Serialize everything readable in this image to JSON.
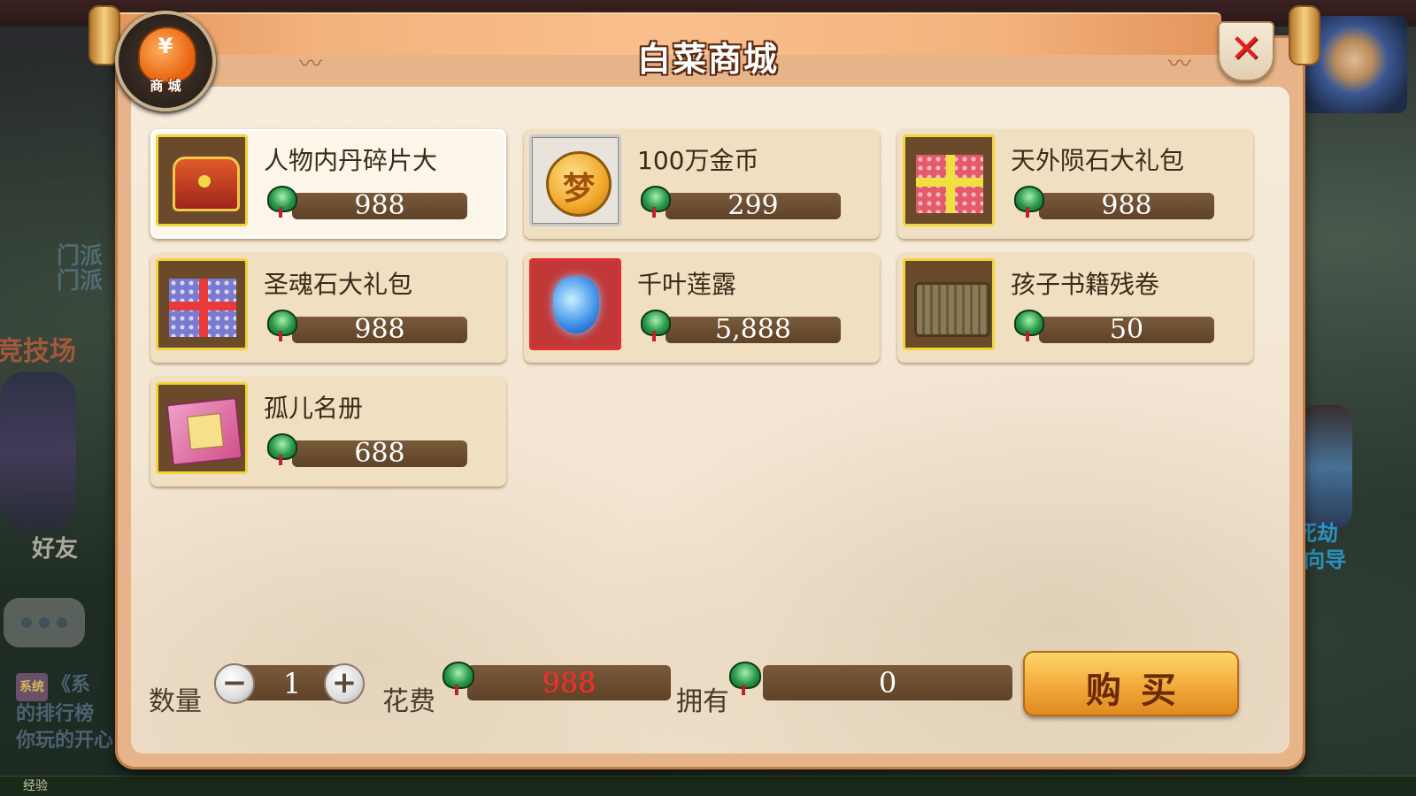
{
  "window": {
    "title": "白菜商城",
    "shop_badge_label": "商 城",
    "shop_badge_symbol": "¥",
    "close_symbol": "✕"
  },
  "items": [
    {
      "name": "人物内丹碎片大",
      "price": "988",
      "icon": "treasure-chest",
      "selected": true
    },
    {
      "name": "100万金币",
      "price": "299",
      "icon": "gold-coin"
    },
    {
      "name": "天外陨石大礼包",
      "price": "988",
      "icon": "pink-gift-box"
    },
    {
      "name": "圣魂石大礼包",
      "price": "988",
      "icon": "blue-gift-box"
    },
    {
      "name": "千叶莲露",
      "price": "5,888",
      "icon": "blue-vase"
    },
    {
      "name": "孩子书籍残卷",
      "price": "50",
      "icon": "wooden-crate"
    },
    {
      "name": "孤儿名册",
      "price": "688",
      "icon": "pink-book"
    }
  ],
  "purchase": {
    "quantity_label": "数量",
    "quantity_value": "1",
    "minus_symbol": "−",
    "plus_symbol": "+",
    "cost_label": "花费",
    "cost_value": "988",
    "own_label": "拥有",
    "own_value": "0",
    "buy_label": "购买"
  },
  "background": {
    "sect_text": "门派\n门派",
    "arena_text": "竞技场",
    "friends_text": "好友",
    "system_badge": "系统",
    "system_text_1": "《系",
    "system_text_2": "的排行榜",
    "system_text_3": "你玩的开心",
    "guide_text_1": "生死劫",
    "guide_text_2": "劫·向导",
    "exp_text": "经验"
  },
  "colors": {
    "dialog": "#e7b48a",
    "panel": "#f3e6d2",
    "price_bar": "#5e4228",
    "cost_value": "#ff2a2a",
    "buy_button": "#f3a93a",
    "close": "#e02020"
  }
}
